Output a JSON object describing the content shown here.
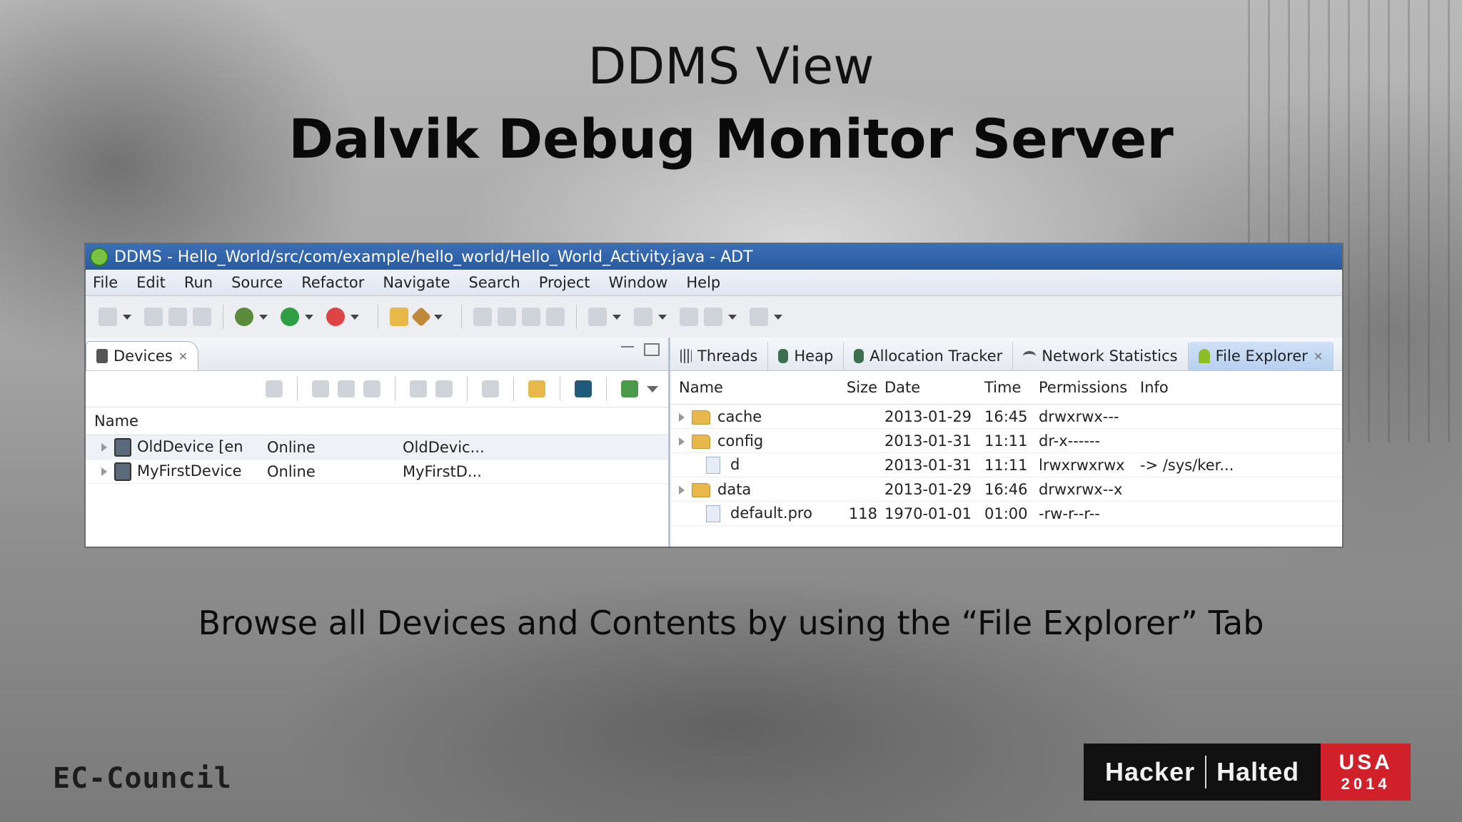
{
  "slide": {
    "title": "DDMS View",
    "subtitle": "Dalvik Debug Monitor Server",
    "caption": "Browse all Devices and Contents by using the “File Explorer” Tab"
  },
  "window": {
    "title": "DDMS - Hello_World/src/com/example/hello_world/Hello_World_Activity.java - ADT",
    "menu": [
      "File",
      "Edit",
      "Run",
      "Source",
      "Refactor",
      "Navigate",
      "Search",
      "Project",
      "Window",
      "Help"
    ]
  },
  "devices_panel": {
    "tab_label": "Devices",
    "column_name": "Name",
    "rows": [
      {
        "name": "OldDevice [en",
        "state": "Online",
        "serial": "OldDevic..."
      },
      {
        "name": "MyFirstDevice",
        "state": "Online",
        "serial": "MyFirstD..."
      }
    ]
  },
  "right_tabs": [
    "Threads",
    "Heap",
    "Allocation Tracker",
    "Network Statistics",
    "File Explorer"
  ],
  "file_explorer": {
    "columns": [
      "Name",
      "Size",
      "Date",
      "Time",
      "Permissions",
      "Info"
    ],
    "rows": [
      {
        "name": "cache",
        "type": "folder",
        "size": "",
        "date": "2013-01-29",
        "time": "16:45",
        "perm": "drwxrwx---",
        "info": ""
      },
      {
        "name": "config",
        "type": "folder",
        "size": "",
        "date": "2013-01-31",
        "time": "11:11",
        "perm": "dr-x------",
        "info": ""
      },
      {
        "name": "d",
        "type": "file",
        "size": "",
        "date": "2013-01-31",
        "time": "11:11",
        "perm": "lrwxrwxrwx",
        "info": "-> /sys/ker..."
      },
      {
        "name": "data",
        "type": "folder",
        "size": "",
        "date": "2013-01-29",
        "time": "16:46",
        "perm": "drwxrwx--x",
        "info": ""
      },
      {
        "name": "default.pro",
        "type": "file",
        "size": "118",
        "date": "1970-01-01",
        "time": "01:00",
        "perm": "-rw-r--r--",
        "info": ""
      }
    ]
  },
  "branding": {
    "org": "EC-Council",
    "event_left": "Hacker",
    "event_right": "Halted",
    "country": "USA",
    "year": "2014"
  }
}
